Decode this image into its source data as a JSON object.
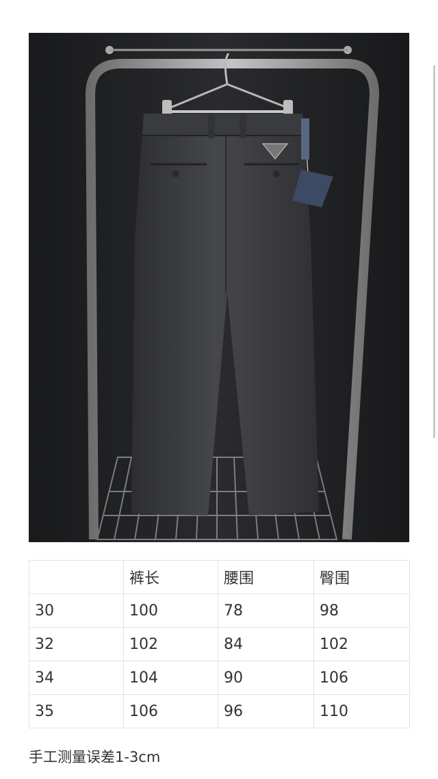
{
  "photo": {
    "alt_subject": "trousers-on-hanger",
    "colors": {
      "background": "#1e1f21",
      "garment": "#3a3b3e",
      "rack": "#9a9a9a",
      "tag": "#3d4a63"
    }
  },
  "size_table": {
    "headers": [
      "",
      "裤长",
      "腰围",
      "臀围"
    ],
    "rows": [
      [
        "30",
        "100",
        "78",
        "98"
      ],
      [
        "32",
        "102",
        "84",
        "102"
      ],
      [
        "34",
        "104",
        "90",
        "106"
      ],
      [
        "35",
        "106",
        "96",
        "110"
      ]
    ]
  },
  "note": "手工测量误差1-3cm"
}
